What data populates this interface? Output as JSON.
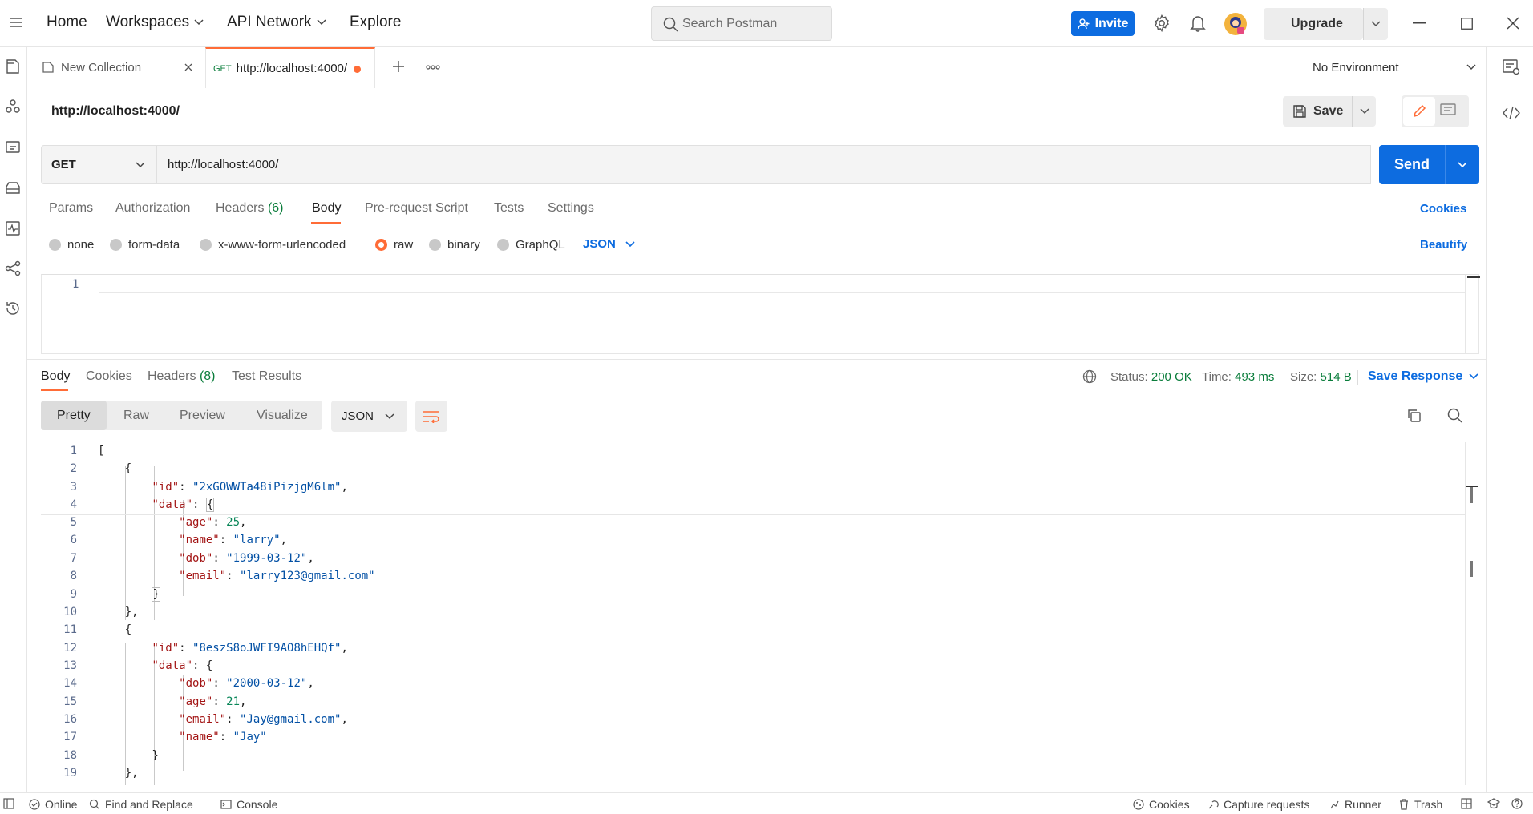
{
  "topbar": {
    "nav": [
      "Home",
      "Workspaces",
      "API Network",
      "Explore"
    ],
    "search_placeholder": "Search Postman",
    "invite_label": "Invite",
    "upgrade_label": "Upgrade"
  },
  "tabs": [
    {
      "label": "New Collection"
    },
    {
      "method": "GET",
      "label": "http://localhost:4000/"
    }
  ],
  "environment": "No Environment",
  "request": {
    "title": "http://localhost:4000/",
    "save_label": "Save",
    "method": "GET",
    "url": "http://localhost:4000/",
    "send_label": "Send",
    "tabs": [
      "Params",
      "Authorization",
      "Headers",
      "Body",
      "Pre-request Script",
      "Tests",
      "Settings"
    ],
    "headers_count": "(6)",
    "cookies_label": "Cookies",
    "body_types": [
      "none",
      "form-data",
      "x-www-form-urlencoded",
      "raw",
      "binary",
      "GraphQL"
    ],
    "body_lang": "JSON",
    "beautify_label": "Beautify",
    "editor_line": "1"
  },
  "response": {
    "tabs": [
      "Body",
      "Cookies",
      "Headers",
      "Test Results"
    ],
    "headers_count": "(8)",
    "status_label": "Status:",
    "status_value": "200 OK",
    "time_label": "Time:",
    "time_value": "493 ms",
    "size_label": "Size:",
    "size_value": "514 B",
    "save_response_label": "Save Response",
    "formats": [
      "Pretty",
      "Raw",
      "Preview",
      "Visualize"
    ],
    "lang": "JSON",
    "lines": [
      "1",
      "2",
      "3",
      "4",
      "5",
      "6",
      "7",
      "8",
      "9",
      "10",
      "11",
      "12",
      "13",
      "14",
      "15",
      "16",
      "17",
      "18",
      "19"
    ],
    "records": [
      {
        "id": "\"2xGOWWTa48iPizjgM6lm\"",
        "age": "25",
        "name": "\"larry\"",
        "dob": "\"1999-03-12\"",
        "email": "\"larry123@gmail.com\""
      },
      {
        "id": "\"8eszS8oJWFI9AO8hEHQf\"",
        "dob": "\"2000-03-12\"",
        "age": "21",
        "email": "\"Jay@gmail.com\"",
        "name": "\"Jay\""
      }
    ]
  },
  "statusbar": {
    "online": "Online",
    "find_replace": "Find and Replace",
    "console": "Console",
    "cookies": "Cookies",
    "capture": "Capture requests",
    "runner": "Runner",
    "trash": "Trash"
  },
  "colors": {
    "accent": "#ff6c37",
    "primary": "#0d6ce0",
    "status_ok": "#0a7d3b"
  }
}
